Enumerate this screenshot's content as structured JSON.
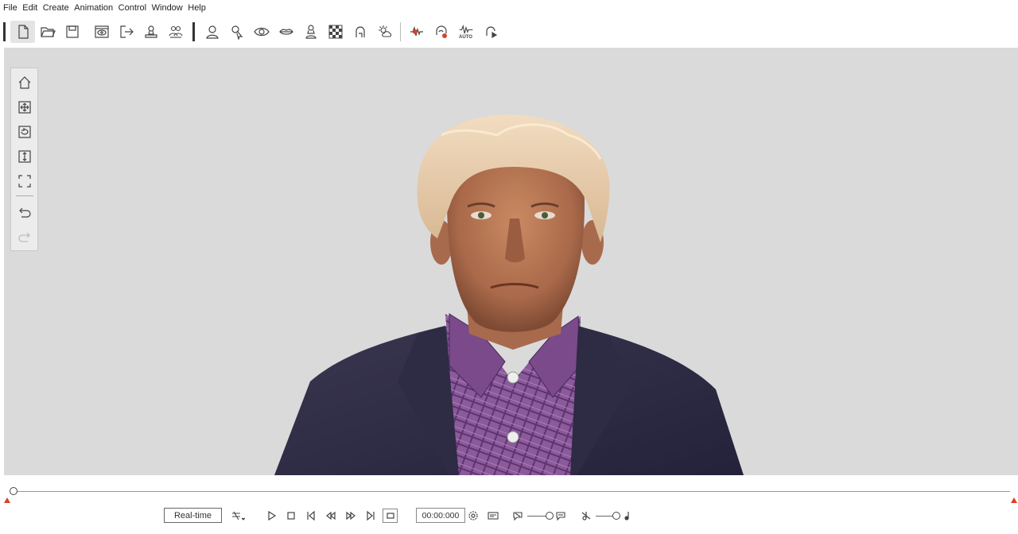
{
  "menu": [
    "File",
    "Edit",
    "Create",
    "Animation",
    "Control",
    "Window",
    "Help"
  ],
  "toolbar": {
    "groups": [
      [
        "new-file-icon",
        "open-folder-icon",
        "save-icon"
      ],
      [
        "preview-icon",
        "export-icon",
        "stamp-icon",
        "crowd-icon"
      ],
      [
        "avatar-icon",
        "select-icon",
        "eye-icon",
        "lips-icon",
        "bust-icon",
        "checker-icon",
        "head-icon",
        "lighting-icon"
      ],
      [
        "audio-record-icon",
        "face-record-icon",
        "auto-wave-icon",
        "head-play-icon"
      ]
    ],
    "auto_label": "AUTO"
  },
  "left_tools": [
    "home-icon",
    "move-icon",
    "rotate-icon",
    "zoom-icon",
    "frame-icon",
    "undo-icon",
    "redo-icon"
  ],
  "timeline": {
    "realtime_label": "Real-time",
    "time": "00:00:000"
  },
  "colors": {
    "accent": "#d9402b",
    "viewport_bg": "#dadada"
  }
}
